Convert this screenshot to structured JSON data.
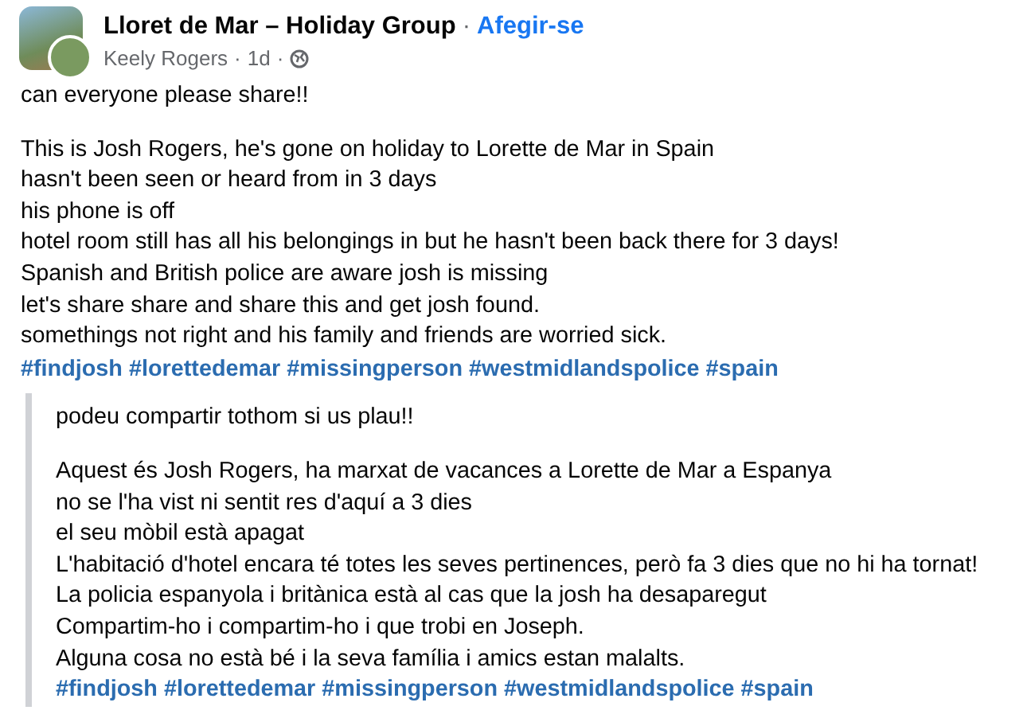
{
  "post": {
    "group_name": "Lloret de Mar – Holiday Group",
    "join_link": "Afegir-se",
    "author": "Keely Rogers",
    "time": "1d",
    "separator": "·"
  },
  "body": {
    "intro": "can everyone please share!!",
    "lines": [
      "This is Josh Rogers, he's gone on holiday to Lorette de Mar in Spain",
      "hasn't been seen or heard from in 3 days",
      "his phone is off",
      "hotel room still has all his belongings in but he hasn't been back there for 3 days!",
      "Spanish and British police are aware josh is missing",
      "let's share share and share this and get josh found.",
      "somethings not right and his family and friends are worried sick."
    ],
    "hashtags": [
      "#findjosh",
      "#lorettedemar",
      "#missingperson",
      "#westmidlandspolice",
      "#spain"
    ]
  },
  "translation": {
    "intro": "podeu compartir tothom si us plau!!",
    "lines": [
      "Aquest és Josh Rogers, ha marxat de vacances a Lorette de Mar a Espanya",
      "no se l'ha vist ni sentit res d'aquí a 3 dies",
      "el seu mòbil està apagat",
      "L'habitació d'hotel encara té totes les seves pertinences, però fa 3 dies que no hi ha tornat!",
      "La policia espanyola i britànica està al cas que la josh ha desaparegut",
      "Compartim-ho i compartim-ho i que trobi en Joseph.",
      "Alguna cosa no està bé i la seva família i amics estan malalts."
    ],
    "hashtags": [
      "#findjosh",
      "#lorettedemar",
      "#missingperson",
      "#westmidlandspolice",
      "#spain"
    ]
  }
}
